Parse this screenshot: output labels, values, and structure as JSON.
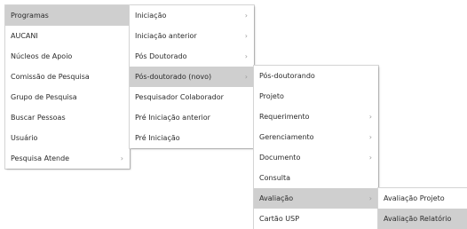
{
  "menu_level1": {
    "items": [
      {
        "label": "Programas",
        "has_submenu": true
      },
      {
        "label": "AUCANI"
      },
      {
        "label": "Núcleos de Apoio"
      },
      {
        "label": "Comissão de Pesquisa"
      },
      {
        "label": "Grupo de Pesquisa"
      },
      {
        "label": "Buscar Pessoas"
      },
      {
        "label": "Usuário"
      },
      {
        "label": "Pesquisa Atende",
        "has_submenu": true
      }
    ]
  },
  "menu_level2": {
    "items": [
      {
        "label": "Iniciação",
        "has_submenu": true
      },
      {
        "label": "Iniciação anterior",
        "has_submenu": true
      },
      {
        "label": "Pós Doutorado",
        "has_submenu": true
      },
      {
        "label": "Pós-doutorado (novo)",
        "has_submenu": true
      },
      {
        "label": "Pesquisador Colaborador"
      },
      {
        "label": "Pré Iniciação anterior"
      },
      {
        "label": "Pré Iniciação"
      }
    ]
  },
  "menu_level3": {
    "items": [
      {
        "label": "Pós-doutorando"
      },
      {
        "label": "Projeto"
      },
      {
        "label": "Requerimento",
        "has_submenu": true
      },
      {
        "label": "Gerenciamento",
        "has_submenu": true
      },
      {
        "label": "Documento",
        "has_submenu": true
      },
      {
        "label": "Consulta"
      },
      {
        "label": "Avaliação",
        "has_submenu": true
      },
      {
        "label": "Cartão USP"
      }
    ]
  },
  "menu_level4": {
    "items": [
      {
        "label": "Avaliação Projeto"
      },
      {
        "label": "Avaliação Relatório"
      }
    ]
  },
  "icons": {
    "submenu_arrow": "›"
  },
  "colors": {
    "highlight": "#cfcfcf",
    "text": "#2b2b2b",
    "arrow": "#9a9a9a"
  }
}
